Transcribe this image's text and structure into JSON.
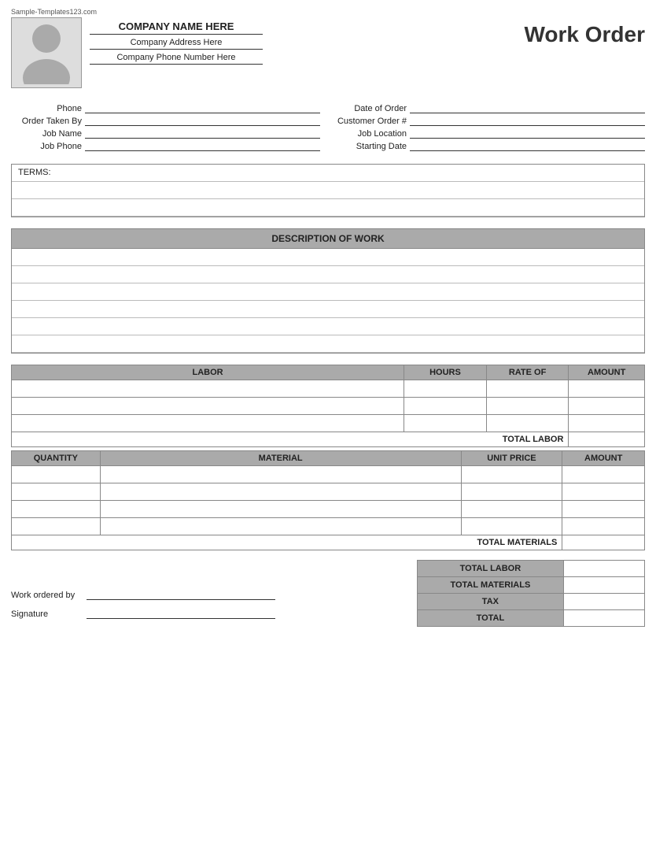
{
  "watermark": "Sample-Templates123.com",
  "company": {
    "name": "COMPANY NAME HERE",
    "address": "Company Address Here",
    "phone": "Company Phone Number Here"
  },
  "title": "Work Order",
  "form": {
    "left": [
      {
        "label": "Phone",
        "value": ""
      },
      {
        "label": "Order Taken By",
        "value": ""
      },
      {
        "label": "Job Name",
        "value": ""
      },
      {
        "label": "Job Phone",
        "value": ""
      }
    ],
    "right": [
      {
        "label": "Date of Order",
        "value": ""
      },
      {
        "label": "Customer Order #",
        "value": ""
      },
      {
        "label": "Job Location",
        "value": ""
      },
      {
        "label": "Starting Date",
        "value": ""
      }
    ]
  },
  "terms_label": "TERMS:",
  "description_header": "DESCRIPTION OF WORK",
  "labor_headers": [
    "LABOR",
    "HOURS",
    "RATE OF",
    "AMOUNT"
  ],
  "labor_rows": 3,
  "total_labor_label": "TOTAL LABOR",
  "material_headers": [
    "QUANTITY",
    "MATERIAL",
    "UNIT PRICE",
    "AMOUNT"
  ],
  "material_rows": 4,
  "total_materials_label": "TOTAL MATERIALS",
  "summary": {
    "labels": [
      "TOTAL LABOR",
      "TOTAL MATERIALS",
      "TAX",
      "TOTAL"
    ]
  },
  "signature": {
    "work_ordered_by": "Work ordered by",
    "signature": "Signature"
  }
}
